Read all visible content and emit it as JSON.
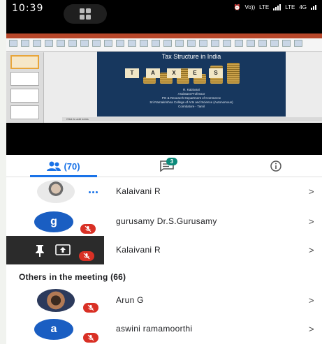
{
  "status_bar": {
    "time": "10:39",
    "network_labels": [
      "Vo))",
      "LTE",
      "LTE",
      "4G"
    ]
  },
  "shared_screen": {
    "slide_title": "Tax Structure in India",
    "slide_letters": [
      "T",
      "A",
      "X",
      "E",
      "S"
    ],
    "slide_author_lines": [
      "R. Kalaivani",
      "Assistant Professor",
      "PG & Research Department of Commerce",
      "Sri Ramakrishna College of Arts and Science (Autonomous)",
      "Coimbatore - Tamil"
    ],
    "notes_placeholder": "Click to add notes"
  },
  "tabs": {
    "people_count": "(70)",
    "chat_badge": "3",
    "active": "people"
  },
  "participants": [
    {
      "name": "Kalaivani R",
      "avatar": "photo",
      "status": "speaking"
    },
    {
      "name": "gurusamy Dr.S.Gurusamy",
      "avatar_letter": "g",
      "status": "muted"
    },
    {
      "name": "Kalaivani R",
      "avatar": "presenting",
      "status": "muted"
    }
  ],
  "others_section": {
    "title": "Others in the meeting (66)"
  },
  "others": [
    {
      "name": "Arun G",
      "avatar": "photo",
      "status": "muted"
    },
    {
      "name": "aswini ramamoorthi",
      "avatar_letter": "a",
      "status": "muted"
    }
  ],
  "colors": {
    "accent": "#1a73e8",
    "muted_red": "#d93025",
    "badge_teal": "#0b8a7a",
    "avatar_blue": "#1a5ec2"
  },
  "chevron": ">"
}
